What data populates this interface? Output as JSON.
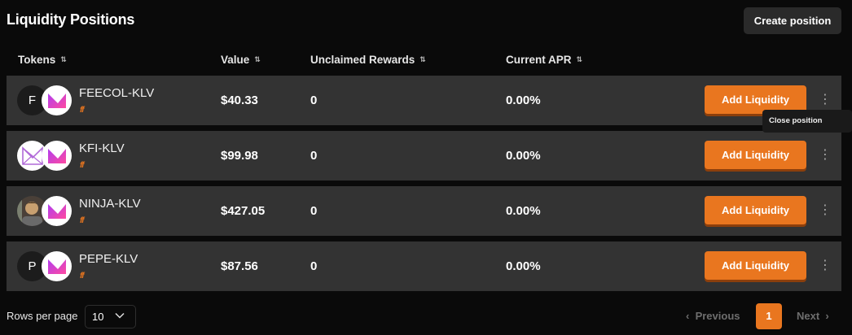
{
  "header": {
    "title": "Liquidity Positions",
    "create_label": "Create position"
  },
  "columns": {
    "tokens": "Tokens",
    "value": "Value",
    "rewards": "Unclaimed Rewards",
    "apr": "Current APR"
  },
  "rows": [
    {
      "avatar_letter": "F",
      "pair": "FEECOL-KLV",
      "tag": "ff",
      "value": "$40.33",
      "rewards": "0",
      "apr": "0.00%"
    },
    {
      "avatar_letter": "",
      "pair": "KFI-KLV",
      "tag": "ff",
      "value": "$99.98",
      "rewards": "0",
      "apr": "0.00%"
    },
    {
      "avatar_letter": "",
      "pair": "NINJA-KLV",
      "tag": "ff",
      "value": "$427.05",
      "rewards": "0",
      "apr": "0.00%"
    },
    {
      "avatar_letter": "P",
      "pair": "PEPE-KLV",
      "tag": "ff",
      "value": "$87.56",
      "rewards": "0",
      "apr": "0.00%"
    }
  ],
  "row_action_label": "Add Liquidity",
  "tooltip": "Close position",
  "footer": {
    "rows_per_page_label": "Rows per page",
    "rows_per_page_value": "10",
    "previous_label": "Previous",
    "current_page": "1",
    "next_label": "Next"
  },
  "colors": {
    "accent": "#e9761f",
    "background": "#0a0a0a",
    "row_background": "#333333",
    "klv_gradient_start": "#b13cf0",
    "klv_gradient_end": "#ff4aa0"
  },
  "icons": {
    "sort": "sort-icon",
    "kebab": "kebab-menu-icon",
    "select_chevron": "chevron-down-icon",
    "previous": "chevron-left-icon",
    "next": "chevron-right-icon"
  }
}
